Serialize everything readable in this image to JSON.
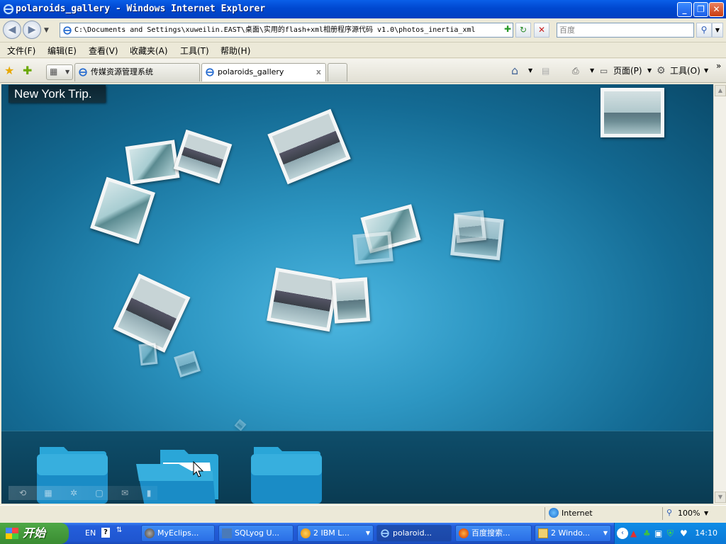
{
  "window": {
    "title": "polaroids_gallery - Windows Internet Explorer",
    "minimize": "_",
    "maximize": "❐",
    "close": "✕"
  },
  "address": {
    "url": "C:\\Documents and Settings\\xuweilin.EAST\\桌面\\实用的flash+xml相册程序源代码 v1.0\\photos_inertia_xml",
    "search_placeholder": "百度",
    "back_icon": "back-arrow-icon",
    "forward_icon": "forward-arrow-icon"
  },
  "menu": {
    "items": [
      "文件(F)",
      "编辑(E)",
      "查看(V)",
      "收藏夹(A)",
      "工具(T)",
      "帮助(H)"
    ]
  },
  "tabs": {
    "items": [
      {
        "label": "传媒资源管理系统",
        "active": false
      },
      {
        "label": "polaroids_gallery",
        "active": true,
        "close": "x"
      }
    ],
    "page_label": "页面(P)",
    "tools_label": "工具(O)",
    "more": "»"
  },
  "gallery": {
    "title": "New York Trip."
  },
  "status": {
    "zone": "Internet",
    "zoom": "100%"
  },
  "taskbar": {
    "start_label": "开始",
    "lang": "EN",
    "tasks": [
      "MyEclips...",
      "SQLyog U...",
      "2 IBM L...",
      "polaroid...",
      "百度搜索...",
      "2 Windo..."
    ],
    "clock": "14:10"
  },
  "colors": {
    "accent_blue": "#0a5fe8",
    "gallery_bg_center": "#4cb6e0",
    "gallery_bg_edge": "#0a4a6a",
    "taskbar_blue": "#245edb",
    "start_green": "#3a8c32"
  }
}
